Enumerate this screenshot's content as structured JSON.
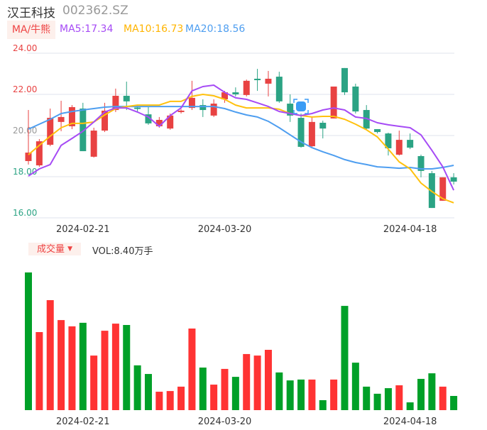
{
  "header": {
    "name": "汉王科技",
    "code": "002362.SZ"
  },
  "indicators": {
    "ma_button": "MA/牛熊",
    "ma5": "MA5:17.34",
    "ma10": "MA10:16.73",
    "ma20": "MA20:18.56"
  },
  "volume_header": {
    "button": "成交量",
    "arrow": "▼",
    "vol": "VOL:8.40万手"
  },
  "colors": {
    "up": "#e84242",
    "down": "#2ba384",
    "ma5": "#a64bf5",
    "ma10": "#ffc10e",
    "ma20": "#4e9ef0",
    "grid": "#dfe3ee"
  },
  "chart_data": {
    "type": "candlestick",
    "y_ticks": [
      "24.00",
      "22.00",
      "20.00",
      "18.00",
      "16.00"
    ],
    "ylim": [
      16,
      24
    ],
    "x_labels": [
      {
        "index": 5,
        "label": "2024-02-21"
      },
      {
        "index": 18,
        "label": "2024-03-20"
      },
      {
        "index": 35,
        "label": "2024-04-18"
      }
    ],
    "candles": [
      [
        18.76,
        19.17,
        21.24,
        18.59
      ],
      [
        18.55,
        19.72,
        19.83,
        18.48
      ],
      [
        19.55,
        20.86,
        21.31,
        19.48
      ],
      [
        20.66,
        20.9,
        21.69,
        20.21
      ],
      [
        20.45,
        21.38,
        21.48,
        20.31
      ],
      [
        21.31,
        19.24,
        21.59,
        19.24
      ],
      [
        18.97,
        20.24,
        20.38,
        18.93
      ],
      [
        20.24,
        21.21,
        21.59,
        20.17
      ],
      [
        21.24,
        21.93,
        22.28,
        21.14
      ],
      [
        21.93,
        21.66,
        22.62,
        21.24
      ],
      [
        21.36,
        21.31,
        21.48,
        21.14
      ],
      [
        21.03,
        20.59,
        21.41,
        20.52
      ],
      [
        20.45,
        20.76,
        20.9,
        20.38
      ],
      [
        20.34,
        20.97,
        21.07,
        20.28
      ],
      [
        21.14,
        21.21,
        21.28,
        21.07
      ],
      [
        21.34,
        21.83,
        22.66,
        21.24
      ],
      [
        21.48,
        21.24,
        21.76,
        20.9
      ],
      [
        20.97,
        21.55,
        21.76,
        20.9
      ],
      [
        21.76,
        22.1,
        22.17,
        21.59
      ],
      [
        22.1,
        22.0,
        22.34,
        21.9
      ],
      [
        21.97,
        22.66,
        22.72,
        21.9
      ],
      [
        22.76,
        22.69,
        23.24,
        22.17
      ],
      [
        22.52,
        22.76,
        23.14,
        21.9
      ],
      [
        22.86,
        21.66,
        23.1,
        21.59
      ],
      [
        21.55,
        20.97,
        22.0,
        20.66
      ],
      [
        20.86,
        19.45,
        21.07,
        19.41
      ],
      [
        19.48,
        20.66,
        20.9,
        19.45
      ],
      [
        20.62,
        20.34,
        20.72,
        19.86
      ],
      [
        20.83,
        22.38,
        22.38,
        20.83
      ],
      [
        23.28,
        22.1,
        23.28,
        21.97
      ],
      [
        22.38,
        21.17,
        22.52,
        21.07
      ],
      [
        21.24,
        20.34,
        21.48,
        20.28
      ],
      [
        20.31,
        20.17,
        20.31,
        20.1
      ],
      [
        20.1,
        19.38,
        20.14,
        19.03
      ],
      [
        19.07,
        19.79,
        20.24,
        19.03
      ],
      [
        19.79,
        19.41,
        20.1,
        19.34
      ],
      [
        19.0,
        18.28,
        19.07,
        17.97
      ],
      [
        18.17,
        16.48,
        18.28,
        16.48
      ],
      [
        16.83,
        17.97,
        17.97,
        16.83
      ],
      [
        17.97,
        17.76,
        18.17,
        17.62
      ]
    ],
    "ma5": [
      18.03,
      18.38,
      18.59,
      19.52,
      19.86,
      20.21,
      20.66,
      21.14,
      21.34,
      21.34,
      21.14,
      20.9,
      20.45,
      20.97,
      21.34,
      22.17,
      22.38,
      22.45,
      22.1,
      21.83,
      21.76,
      21.59,
      21.41,
      21.17,
      21.07,
      20.97,
      21.07,
      21.24,
      21.34,
      21.24,
      20.9,
      20.83,
      20.62,
      20.52,
      20.45,
      20.38,
      20.03,
      19.28,
      18.48,
      17.34
    ],
    "ma10": [
      19.07,
      19.52,
      19.97,
      20.38,
      20.59,
      20.59,
      20.66,
      21.0,
      21.31,
      21.41,
      21.48,
      21.48,
      21.48,
      21.66,
      21.66,
      21.9,
      22.0,
      21.93,
      21.76,
      21.48,
      21.34,
      21.34,
      21.34,
      21.28,
      21.07,
      20.97,
      20.9,
      20.93,
      20.93,
      20.79,
      20.55,
      20.28,
      19.93,
      19.34,
      18.72,
      18.38,
      17.69,
      17.28,
      16.93,
      16.73
    ],
    "ma20": [
      20.31,
      20.55,
      20.79,
      21.07,
      21.17,
      21.24,
      21.31,
      21.38,
      21.41,
      21.41,
      21.41,
      21.41,
      21.41,
      21.41,
      21.41,
      21.41,
      21.41,
      21.41,
      21.31,
      21.14,
      21.0,
      20.9,
      20.69,
      20.38,
      20.03,
      19.69,
      19.41,
      19.21,
      19.03,
      18.83,
      18.69,
      18.59,
      18.48,
      18.45,
      18.41,
      18.45,
      18.38,
      18.38,
      18.45,
      18.55
    ],
    "volume_unit": "万手",
    "volume": [
      81.5,
      46.2,
      65.1,
      53.3,
      49.6,
      51.7,
      32.3,
      47.0,
      51.2,
      50.4,
      26.5,
      21.4,
      10.9,
      11.3,
      13.9,
      48.3,
      25.2,
      15.1,
      24.4,
      19.7,
      33.2,
      32.3,
      35.7,
      22.3,
      17.6,
      18.1,
      18.1,
      5.9,
      18.1,
      61.7,
      28.1,
      13.9,
      9.7,
      13.0,
      14.7,
      4.6,
      18.5,
      21.8,
      13.9,
      8.4
    ],
    "volume_up": [
      0,
      1,
      1,
      1,
      1,
      0,
      1,
      1,
      1,
      0,
      0,
      0,
      1,
      1,
      1,
      1,
      0,
      1,
      1,
      0,
      1,
      1,
      1,
      0,
      0,
      0,
      1,
      0,
      1,
      0,
      0,
      0,
      0,
      0,
      1,
      0,
      0,
      0,
      1,
      0
    ]
  }
}
